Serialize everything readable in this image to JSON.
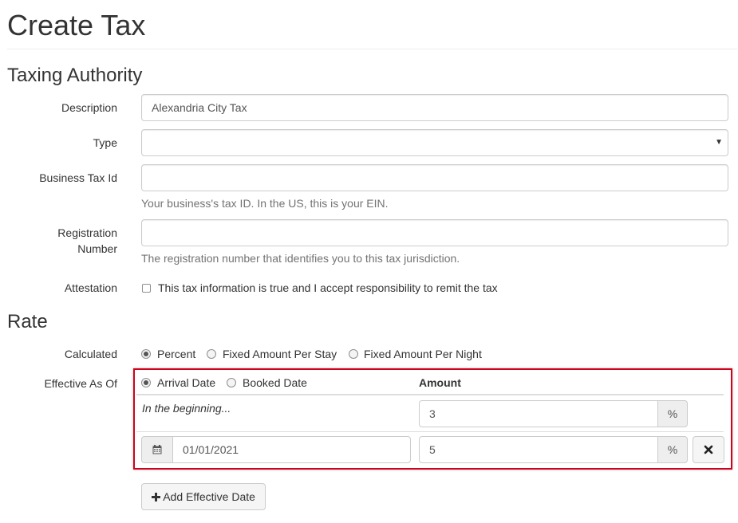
{
  "page_title": "Create Tax",
  "taxing_authority": {
    "heading": "Taxing Authority",
    "description": {
      "label": "Description",
      "value": "Alexandria City Tax"
    },
    "type": {
      "label": "Type",
      "value": ""
    },
    "business_tax_id": {
      "label": "Business Tax Id",
      "value": "",
      "help": "Your business's tax ID. In the US, this is your EIN."
    },
    "registration_number": {
      "label_line1": "Registration",
      "label_line2": "Number",
      "value": "",
      "help": "The registration number that identifies you to this tax jurisdiction."
    },
    "attestation": {
      "label": "Attestation",
      "text": "This tax information is true and I accept responsibility to remit the tax",
      "checked": false
    }
  },
  "rate": {
    "heading": "Rate",
    "calculated": {
      "label": "Calculated",
      "options": [
        "Percent",
        "Fixed Amount Per Stay",
        "Fixed Amount Per Night"
      ],
      "selected": "Percent"
    },
    "effective_as_of": {
      "label": "Effective As Of",
      "options": [
        "Arrival Date",
        "Booked Date"
      ],
      "selected": "Arrival Date",
      "amount_header": "Amount",
      "rows": [
        {
          "start": "In the beginning...",
          "amount": "3",
          "unit": "%"
        },
        {
          "date": "01/01/2021",
          "amount": "5",
          "unit": "%"
        }
      ]
    },
    "add_button_label": "Add Effective Date"
  },
  "icons": {
    "select_arrow": "caret-down-icon",
    "calendar": "calendar-icon",
    "remove": "remove-icon",
    "plus": "plus-icon"
  },
  "colors": {
    "highlight_border": "#d0021b"
  }
}
